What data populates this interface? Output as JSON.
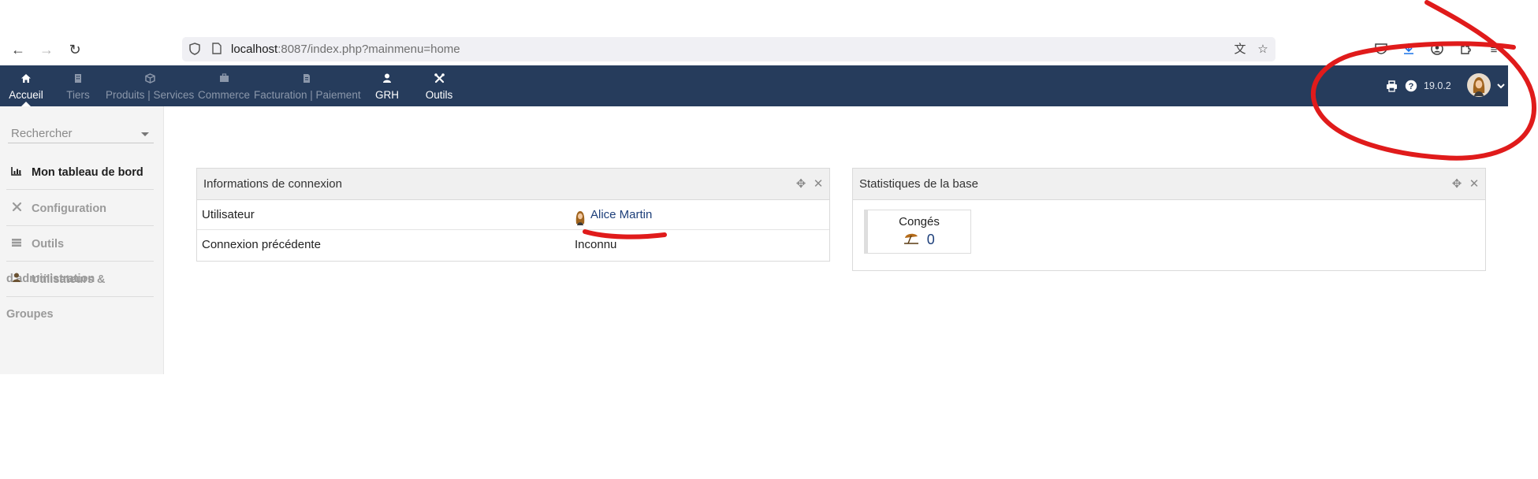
{
  "browser": {
    "url_host": "localhost",
    "url_rest": ":8087/index.php?mainmenu=home",
    "icons": [
      "back-arrow-icon",
      "forward-arrow-icon",
      "reload-icon",
      "shield-icon",
      "page-icon",
      "translate-icon",
      "star-icon",
      "pocket-icon",
      "download-icon",
      "account-icon",
      "extensions-icon",
      "menu-icon"
    ]
  },
  "topmenu": {
    "items": [
      {
        "label": "Accueil",
        "icon": "home-icon"
      },
      {
        "label": "Tiers",
        "icon": "building-icon"
      },
      {
        "label": "Produits | Services",
        "icon": "cube-icon"
      },
      {
        "label": "Commerce",
        "icon": "briefcase-icon"
      },
      {
        "label": "Facturation | Paiement",
        "icon": "invoice-icon"
      },
      {
        "label": "GRH",
        "icon": "user-icon"
      },
      {
        "label": "Outils",
        "icon": "tools-icon"
      }
    ],
    "version": "19.0.2",
    "colors": {
      "bar": "#263c5c",
      "active": "#ffffff",
      "inactive": "#8b97aa"
    }
  },
  "sidebar": {
    "search_placeholder": "Rechercher",
    "items": [
      {
        "label": "Mon tableau de bord",
        "icon": "chart-icon"
      },
      {
        "label": "Configuration",
        "icon": "tools-icon"
      },
      {
        "label": "Outils d'administration",
        "icon": "server-icon"
      },
      {
        "label": "Utilisateurs & Groupes",
        "icon": "user-icon"
      }
    ]
  },
  "login_box": {
    "title": "Informations de connexion",
    "rows": [
      {
        "key": "Utilisateur",
        "value": "Alice Martin"
      },
      {
        "key": "Connexion précédente",
        "value": "Inconnu"
      }
    ]
  },
  "stats_box": {
    "title": "Statistiques de la base",
    "cards": [
      {
        "label": "Congés",
        "value": "0",
        "icon": "beach-umbrella-icon"
      }
    ]
  },
  "annotation_color": "#e01b1b"
}
